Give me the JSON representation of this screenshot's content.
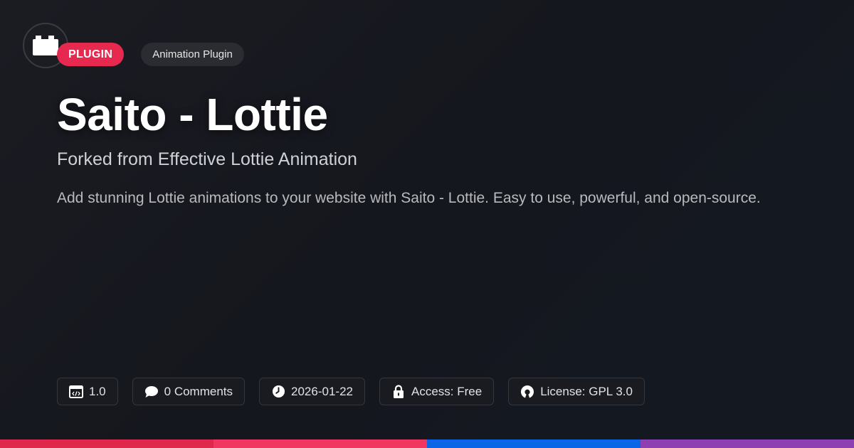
{
  "logo": {
    "icon": "plugin-block-icon"
  },
  "badges": {
    "type_label": "PLUGIN",
    "category_label": "Animation Plugin"
  },
  "title": "Saito - Lottie",
  "subtitle": "Forked from Effective Lottie Animation",
  "description": "Add stunning Lottie animations to your website with Saito - Lottie. Easy to use, powerful, and open-source.",
  "meta": {
    "version": "1.0",
    "comments": "0 Comments",
    "date": "2026-01-22",
    "access": "Access: Free",
    "license": "License: GPL 3.0"
  },
  "colors": {
    "accent": "#e8294f",
    "bar": [
      "#e0284d",
      "#f23662",
      "#0a66e6",
      "#8e3fb1"
    ]
  }
}
